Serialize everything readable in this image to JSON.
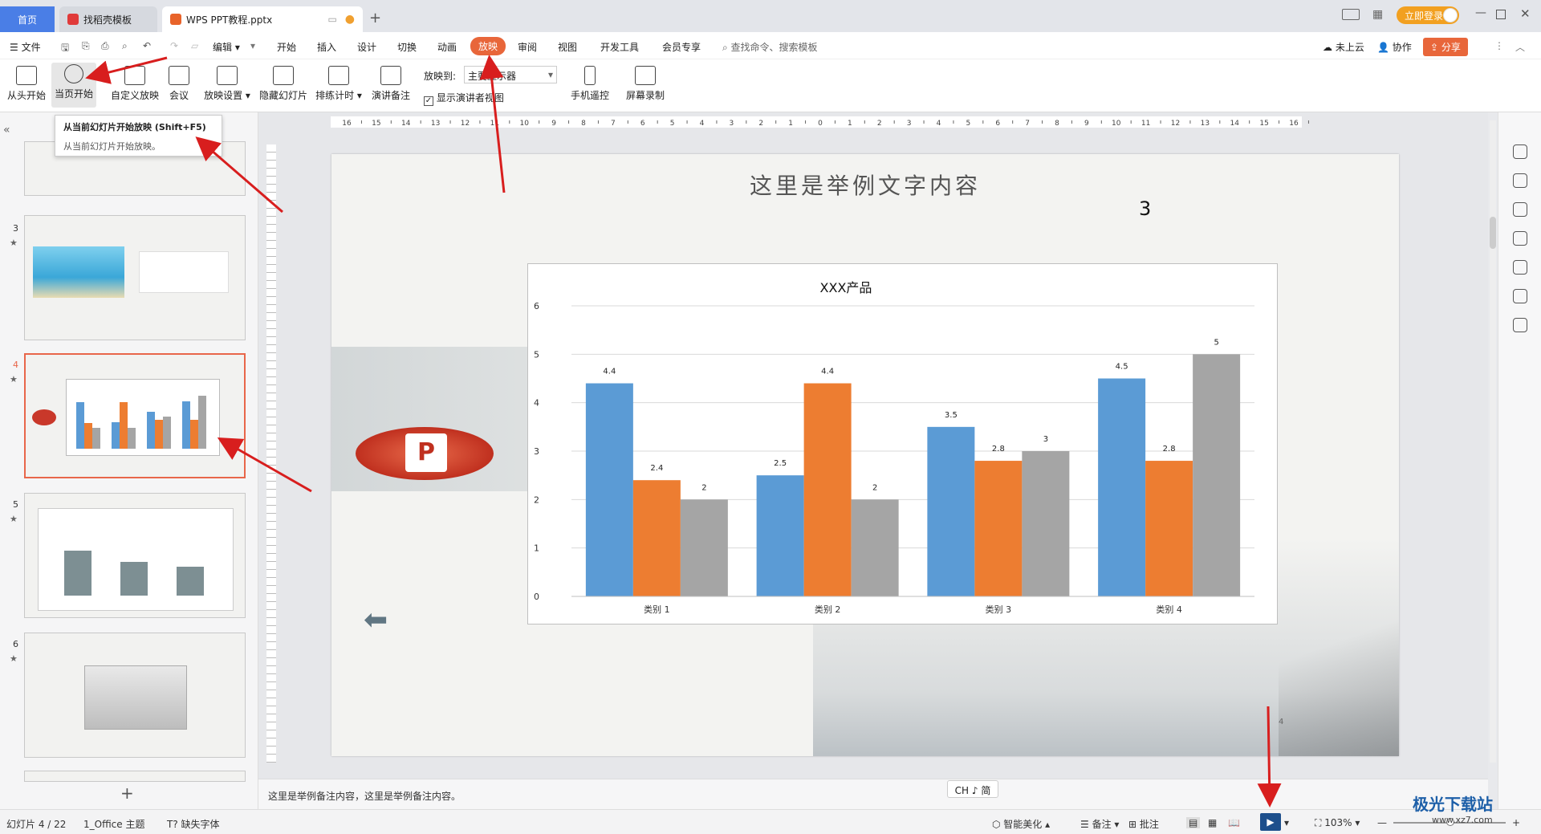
{
  "titlebar": {
    "tabs": [
      {
        "label": "首页"
      },
      {
        "label": "找稻壳模板"
      },
      {
        "label": "WPS PPT教程.pptx"
      }
    ],
    "login_label": "立即登录"
  },
  "menubar": {
    "file_label": "文件",
    "edit_label": "编辑",
    "items": [
      "开始",
      "插入",
      "设计",
      "切换",
      "动画",
      "放映",
      "审阅",
      "视图",
      "开发工具",
      "会员专享"
    ],
    "active_item": "放映",
    "search_placeholder": "查找命令、搜索模板",
    "cloud_label": "未上云",
    "collab_label": "协作",
    "share_label": "分享"
  },
  "ribbon": {
    "buttons": [
      "从头开始",
      "当页开始",
      "自定义放映",
      "会议",
      "放映设置",
      "隐藏幻灯片",
      "排练计时",
      "演讲备注"
    ],
    "play_to_label": "放映到:",
    "play_to_value": "主要显示器",
    "presenter_view_label": "显示演讲者视图",
    "phone_remote_label": "手机遥控",
    "screen_record_label": "屏幕录制"
  },
  "tooltip": {
    "title": "从当前幻灯片开始放映 (Shift+F5)",
    "desc": "从当前幻灯片开始放映。"
  },
  "ruler": {
    "labels": [
      "16",
      "15",
      "14",
      "13",
      "12",
      "11",
      "10",
      "9",
      "8",
      "7",
      "6",
      "5",
      "4",
      "3",
      "2",
      "1",
      "0",
      "1",
      "2",
      "3",
      "4",
      "5",
      "6",
      "7",
      "8",
      "9",
      "10",
      "11",
      "12",
      "13",
      "14",
      "15",
      "16"
    ]
  },
  "thumbs": [
    {
      "num": "3"
    },
    {
      "num": "4"
    },
    {
      "num": "5"
    },
    {
      "num": "6"
    }
  ],
  "slide": {
    "title": "这里是举例文字内容",
    "number": "3",
    "page_marker": "4"
  },
  "chart_data": {
    "type": "bar",
    "title": "XXX产品",
    "categories": [
      "类别 1",
      "类别 2",
      "类别 3",
      "类别 4"
    ],
    "series": [
      {
        "values": [
          4.4,
          2.5,
          3.5,
          4.5
        ],
        "color": "#5b9bd5"
      },
      {
        "values": [
          2.4,
          4.4,
          2.8,
          2.8
        ],
        "color": "#ed7d31"
      },
      {
        "values": [
          2,
          2,
          3,
          5
        ],
        "color": "#a5a5a5"
      }
    ],
    "ylim": [
      0,
      6
    ],
    "yticks": [
      "0",
      "1",
      "2",
      "3",
      "4",
      "5",
      "6"
    ],
    "grid": true
  },
  "notes": {
    "text": "这里是举例备注内容，这里是举例备注内容。"
  },
  "ime": {
    "label": "CH ♪ 简"
  },
  "status": {
    "slide_info": "幻灯片 4 / 22",
    "theme": "1_Office 主题",
    "missing_font": "缺失字体",
    "beautify": "智能美化",
    "notes_label": "备注",
    "comment_label": "批注",
    "zoom": "103%"
  },
  "watermark": {
    "text": "极光下载站",
    "url": "www.xz7.com"
  }
}
